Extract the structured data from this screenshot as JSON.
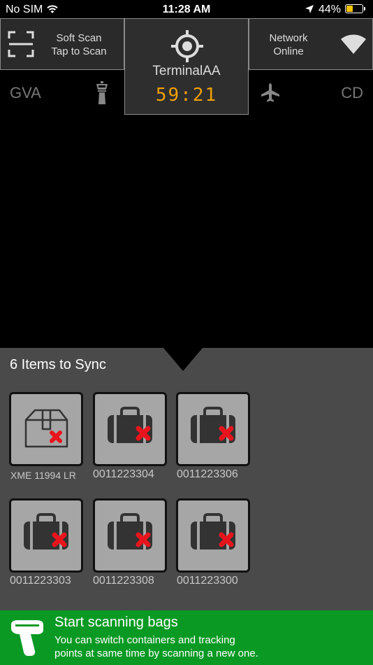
{
  "status_bar": {
    "carrier": "No SIM",
    "time": "11:28 AM",
    "battery_percent": "44%",
    "battery_level": 0.44,
    "icons": [
      "wifi-icon",
      "location-arrow-icon",
      "battery-icon"
    ]
  },
  "header": {
    "soft_scan": {
      "line1": "Soft Scan",
      "line2": "Tap to Scan",
      "icon": "scan-frame-icon"
    },
    "terminal": {
      "name": "TerminalAA",
      "timer": "59:21",
      "icon": "target-icon"
    },
    "network": {
      "line1": "Network",
      "line2": "Online",
      "icon": "wifi-icon"
    }
  },
  "route": {
    "origin": "GVA",
    "destination": "CD",
    "origin_icon": "control-tower-icon",
    "destination_icon": "airplane-icon"
  },
  "sync": {
    "title": "6 Items to Sync",
    "items": [
      {
        "label": "XME 11994 LR",
        "type": "container",
        "icon": "box-icon",
        "status": "error"
      },
      {
        "label": "0011223304",
        "type": "bag",
        "icon": "suitcase-icon",
        "status": "error"
      },
      {
        "label": "0011223306",
        "type": "bag",
        "icon": "suitcase-icon",
        "status": "error"
      },
      {
        "label": "0011223303",
        "type": "bag",
        "icon": "suitcase-icon",
        "status": "error"
      },
      {
        "label": "0011223308",
        "type": "bag",
        "icon": "suitcase-icon",
        "status": "error"
      },
      {
        "label": "0011223300",
        "type": "bag",
        "icon": "suitcase-icon",
        "status": "error"
      }
    ]
  },
  "banner": {
    "title": "Start scanning bags",
    "body": "You can switch containers and tracking\n points at same time by scanning a new one.",
    "icon": "barcode-scanner-icon"
  },
  "colors": {
    "background": "#000000",
    "panel": "#4a4a4a",
    "tile": "#a6a6a6",
    "timer": "#f0a000",
    "banner": "#0a9a24",
    "error_x": "#e8141c",
    "battery": "#f5c400"
  }
}
